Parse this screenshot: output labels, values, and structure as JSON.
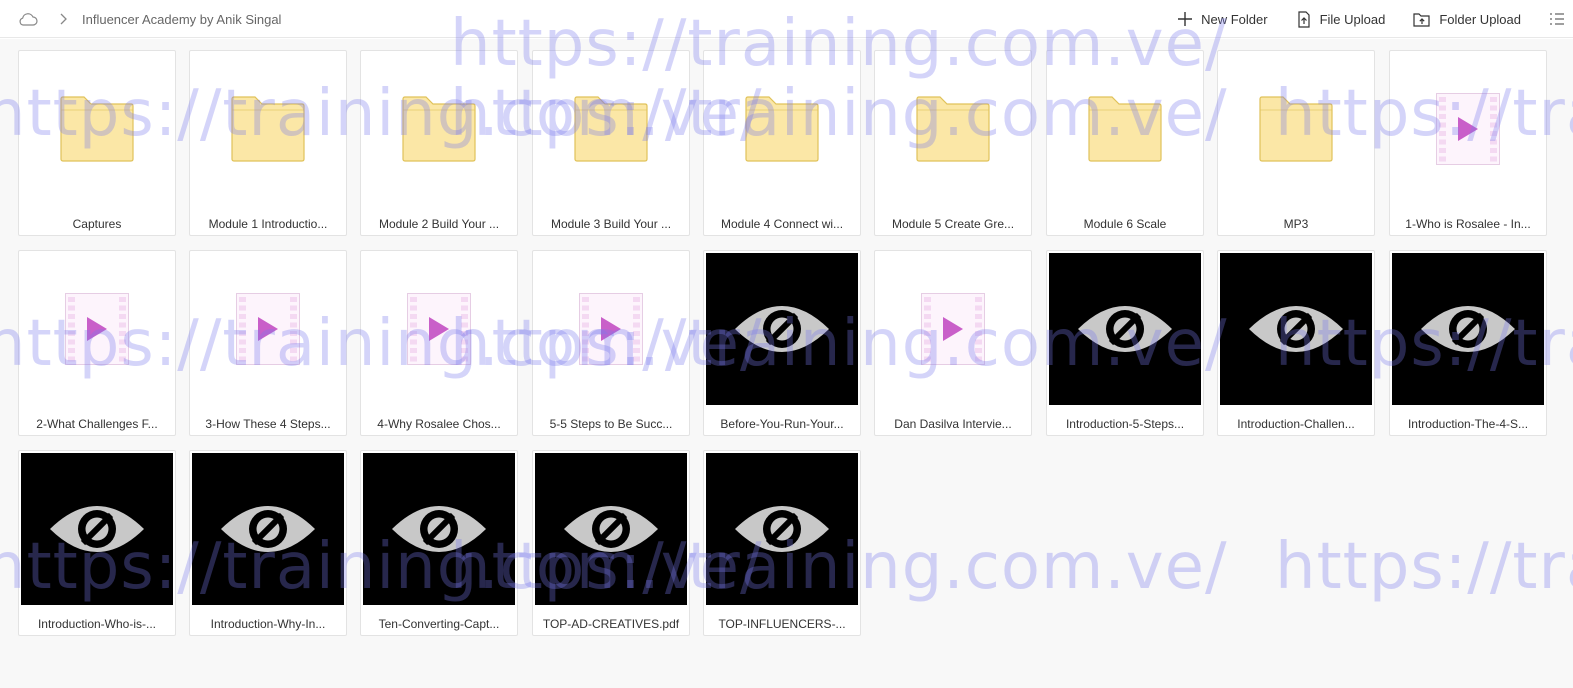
{
  "breadcrumb": {
    "path": "Influencer Academy by Anik Singal"
  },
  "toolbar": {
    "new_folder": "New Folder",
    "file_upload": "File Upload",
    "folder_upload": "Folder Upload"
  },
  "colors": {
    "folder_fill": "#fbe7a6",
    "folder_stroke": "#e0c25a",
    "video_play": "#c95fc9",
    "video_strip": "#f4d9f2",
    "preview_bg": "#000000",
    "preview_icon": "#c8c8c8",
    "watermark": "#7878eb"
  },
  "watermark": {
    "text": "https://training.com.ve/"
  },
  "items": [
    {
      "name": "Captures",
      "icon": "folder-icon"
    },
    {
      "name": "Module 1 Introductio...",
      "icon": "folder-icon"
    },
    {
      "name": "Module 2 Build Your ...",
      "icon": "folder-icon"
    },
    {
      "name": "Module 3 Build Your ...",
      "icon": "folder-icon"
    },
    {
      "name": "Module 4 Connect wi...",
      "icon": "folder-icon"
    },
    {
      "name": "Module 5 Create Gre...",
      "icon": "folder-icon"
    },
    {
      "name": "Module 6 Scale",
      "icon": "folder-icon"
    },
    {
      "name": "MP3",
      "icon": "folder-icon"
    },
    {
      "name": "1-Who is Rosalee - In...",
      "icon": "video-file-icon"
    },
    {
      "name": "2-What Challenges F...",
      "icon": "video-file-icon"
    },
    {
      "name": "3-How These 4 Steps...",
      "icon": "video-file-icon"
    },
    {
      "name": "4-Why Rosalee Chos...",
      "icon": "video-file-icon"
    },
    {
      "name": "5-5 Steps to Be Succ...",
      "icon": "video-file-icon"
    },
    {
      "name": "Before-You-Run-Your...",
      "icon": "hidden-preview-icon"
    },
    {
      "name": "Dan Dasilva Intervie...",
      "icon": "video-file-icon"
    },
    {
      "name": "Introduction-5-Steps...",
      "icon": "hidden-preview-icon"
    },
    {
      "name": "Introduction-Challen...",
      "icon": "hidden-preview-icon"
    },
    {
      "name": "Introduction-The-4-S...",
      "icon": "hidden-preview-icon"
    },
    {
      "name": "Introduction-Who-is-...",
      "icon": "hidden-preview-icon"
    },
    {
      "name": "Introduction-Why-In...",
      "icon": "hidden-preview-icon"
    },
    {
      "name": "Ten-Converting-Capt...",
      "icon": "hidden-preview-icon"
    },
    {
      "name": "TOP-AD-CREATIVES.pdf",
      "icon": "hidden-preview-icon"
    },
    {
      "name": "TOP-INFLUENCERS-...",
      "icon": "hidden-preview-icon"
    }
  ]
}
